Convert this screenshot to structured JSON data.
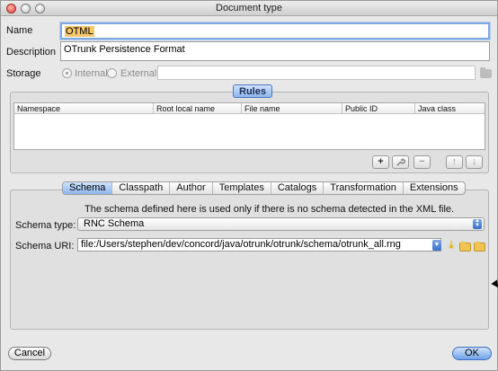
{
  "window": {
    "title": "Document type"
  },
  "form": {
    "name_label": "Name",
    "name_value": "OTML",
    "description_label": "Description",
    "description_value": "OTrunk Persistence Format",
    "storage_label": "Storage",
    "storage_options": [
      "Internal",
      "External"
    ],
    "storage_selected": "Internal",
    "storage_path": ""
  },
  "rules": {
    "title": "Rules",
    "columns": [
      "Namespace",
      "Root local name",
      "File name",
      "Public ID",
      "Java class"
    ],
    "rows": [],
    "buttons": {
      "add": "+",
      "edit": "wrench-icon",
      "remove": "−",
      "up": "↑",
      "down": "↓"
    }
  },
  "tabs": {
    "items": [
      "Schema",
      "Classpath",
      "Author",
      "Templates",
      "Catalogs",
      "Transformation",
      "Extensions"
    ],
    "active": "Schema"
  },
  "schema": {
    "info_text": "The schema defined here is used only if there is no schema detected in the XML file.",
    "type_label": "Schema type:",
    "type_value": "RNC Schema",
    "uri_label": "Schema URI:",
    "uri_value": "file:/Users/stephen/dev/concord/java/otrunk/otrunk/schema/otrunk_all.rng"
  },
  "footer": {
    "cancel_label": "Cancel",
    "ok_label": "OK"
  },
  "colors": {
    "accent_blue": "#8eb6ec",
    "selection": "#f5c66a",
    "close_button": "#e0443a"
  }
}
